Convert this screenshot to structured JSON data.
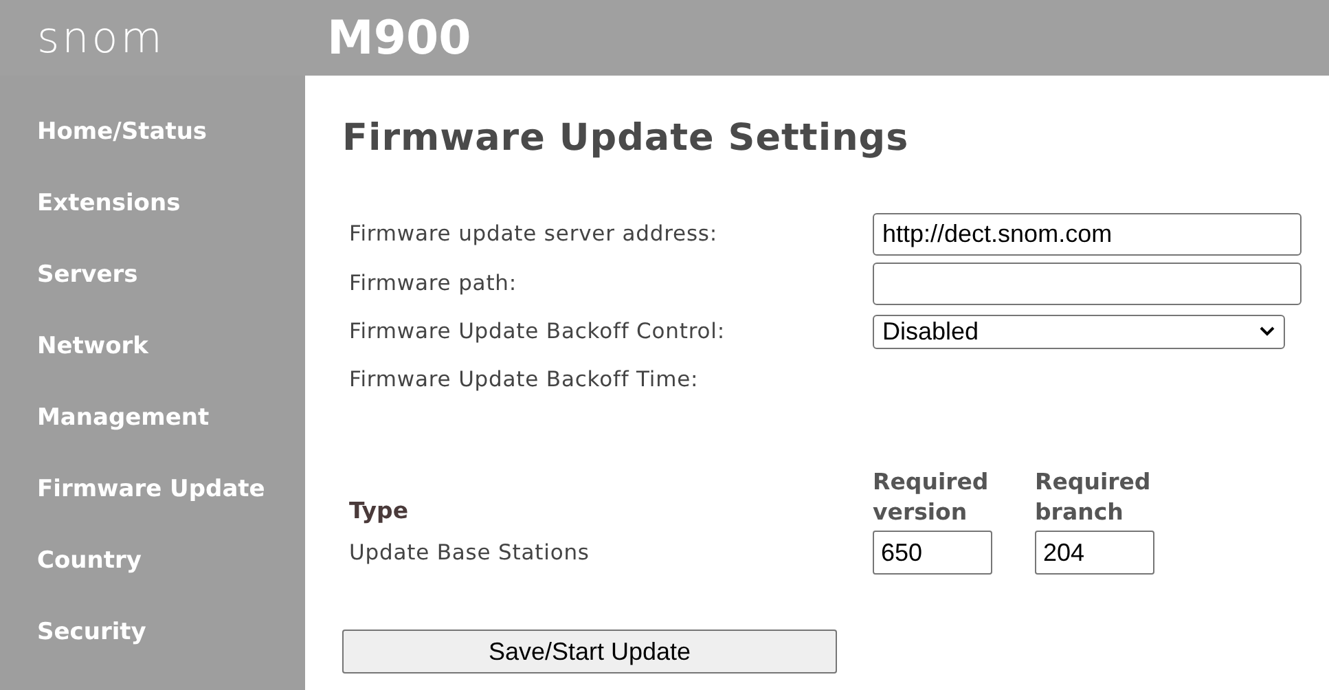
{
  "logo": "snom",
  "header": {
    "title": "M900"
  },
  "sidebar": {
    "items": [
      "Home/Status",
      "Extensions",
      "Servers",
      "Network",
      "Management",
      "Firmware Update",
      "Country",
      "Security"
    ]
  },
  "page": {
    "title": "Firmware Update Settings"
  },
  "settings": [
    {
      "kind": "text",
      "label": "Firmware update server address:",
      "value": "http://dect.snom.com"
    },
    {
      "kind": "text",
      "label": "Firmware path:"
    },
    {
      "kind": "select",
      "label": "Firmware Update Backoff Control:",
      "value": "Disabled"
    },
    {
      "kind": "none",
      "label": "Firmware Update Backoff Time:"
    }
  ],
  "update_table": {
    "columns": [
      "Type",
      "Required version",
      "Required branch"
    ],
    "rows": [
      {
        "type": "Update Base Stations",
        "version": "650",
        "branch": "204"
      }
    ]
  },
  "save_button": "Save/Start Update"
}
